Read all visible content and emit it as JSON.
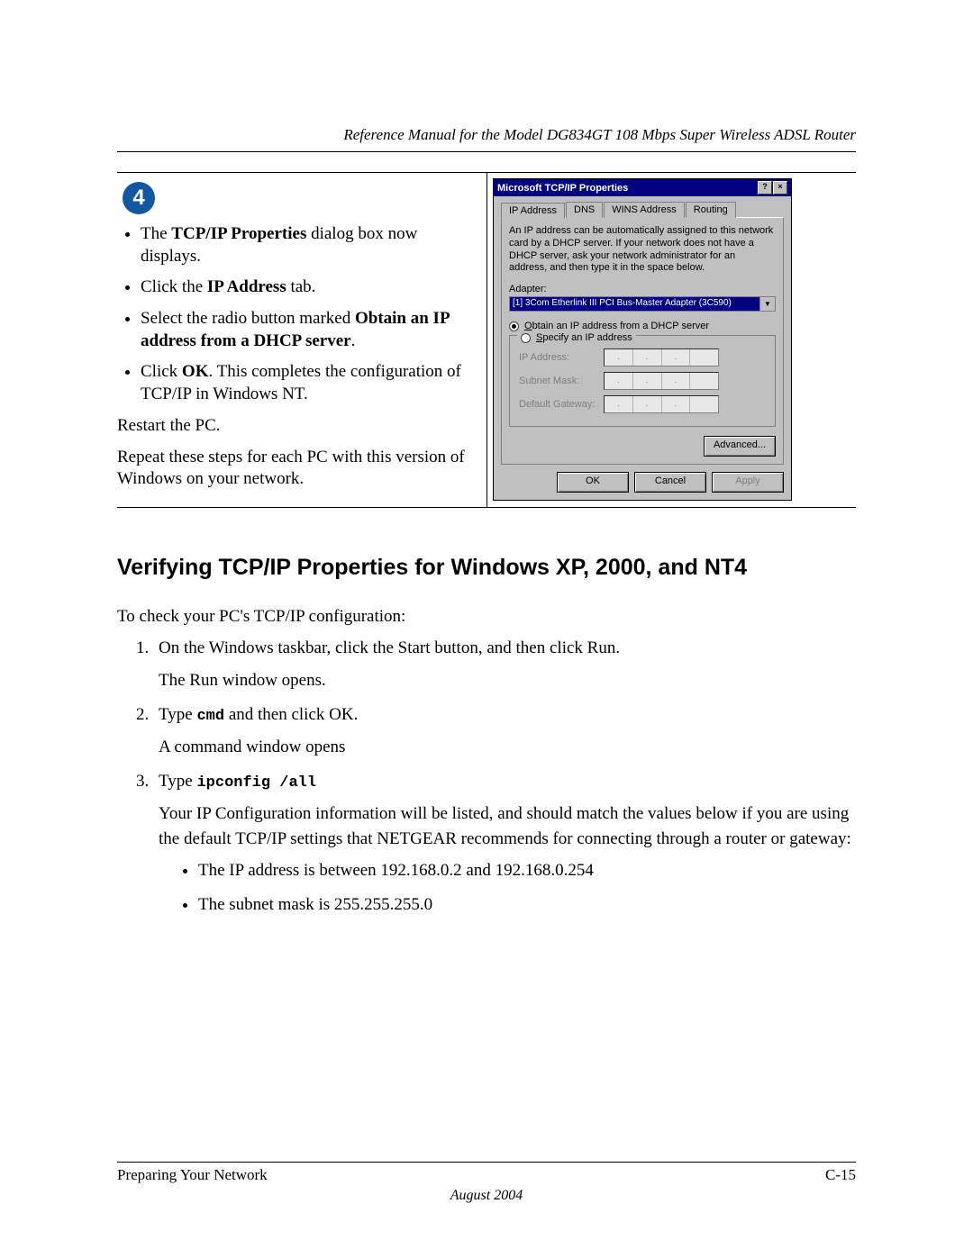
{
  "header": {
    "title": "Reference Manual for the Model DG834GT 108 Mbps Super Wireless ADSL Router"
  },
  "step": {
    "number": "4",
    "bullets": [
      {
        "pre": "The ",
        "b": "TCP/IP Properties",
        "post": " dialog box now displays."
      },
      {
        "pre": "Click the ",
        "b": "IP Address",
        "post": " tab."
      },
      {
        "pre": "Select the radio button marked ",
        "b": "Obtain an IP address from a DHCP server",
        "post": "."
      },
      {
        "pre": "Click ",
        "b": "OK",
        "post": ".  This completes the configuration of TCP/IP in Windows NT."
      }
    ],
    "p1": "Restart the PC.",
    "p2": "Repeat these steps for each PC with this version of Windows on your network."
  },
  "dialog": {
    "title": "Microsoft TCP/IP Properties",
    "helpGlyph": "?",
    "closeGlyph": "×",
    "tabs": [
      "IP Address",
      "DNS",
      "WINS Address",
      "Routing"
    ],
    "note": "An IP address can be automatically assigned to this network card by a DHCP server. If your network does not have a DHCP server, ask your network administrator for an address, and then type it in the space below.",
    "adapterLabel": "Adapter:",
    "adapterValue": "[1] 3Com Etherlink III PCI Bus-Master Adapter (3C590)",
    "radios": [
      {
        "checked": true,
        "labelPre": "O",
        "labelRest": "btain an IP address from a DHCP server"
      },
      {
        "checked": false,
        "labelPre": "S",
        "labelRest": "pecify an IP address"
      }
    ],
    "fields": [
      {
        "label": "IP Address:"
      },
      {
        "label": "Subnet Mask:"
      },
      {
        "label": "Default Gateway:"
      }
    ],
    "buttons": {
      "advanced": "Advanced...",
      "ok": "OK",
      "cancel": "Cancel",
      "apply": "Apply"
    }
  },
  "section": {
    "heading": "Verifying TCP/IP Properties for Windows XP, 2000, and NT4",
    "intro": "To check your PC's TCP/IP configuration:",
    "steps": [
      {
        "main": "On the Windows taskbar, click the Start button, and then click Run.",
        "after": "The Run window opens."
      },
      {
        "mainPre": "Type ",
        "code": "cmd",
        "mainPost": " and then click OK.",
        "after": "A command window opens"
      },
      {
        "mainPre": "Type ",
        "code": "ipconfig /all",
        "mainPost": "",
        "after": "Your IP Configuration information will be listed, and should match the values below if you are using the default TCP/IP settings that NETGEAR recommends for connecting through a router or gateway:",
        "sub": [
          "The IP address is between 192.168.0.2 and 192.168.0.254",
          "The subnet mask is 255.255.255.0"
        ]
      }
    ]
  },
  "footer": {
    "left": "Preparing Your Network",
    "right": "C-15",
    "date": "August 2004"
  }
}
